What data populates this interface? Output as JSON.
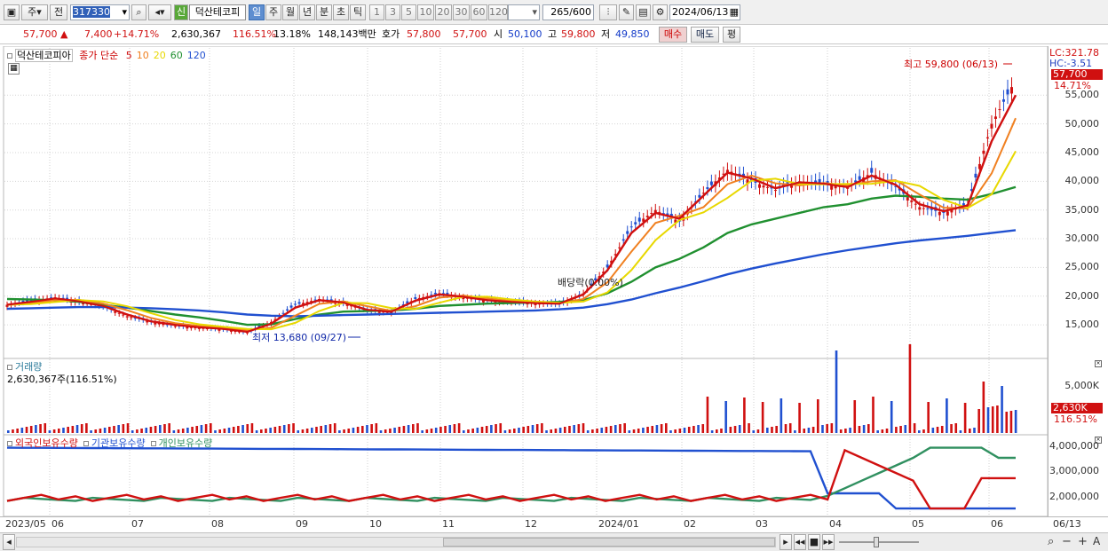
{
  "toolbar": {
    "type_label": "주",
    "period_label": "전",
    "code": "317330",
    "new_badge": "신",
    "name": "덕산테코피",
    "periods": [
      "일",
      "주",
      "월",
      "년",
      "분",
      "초",
      "틱"
    ],
    "selected_period": "일",
    "numbers": [
      "1",
      "3",
      "5",
      "10",
      "20",
      "30",
      "60",
      "120"
    ],
    "count": "265",
    "count_total": "/600",
    "date": "2024/06/13"
  },
  "quote": {
    "price": "57,700",
    "change": "7,400",
    "change_pct": "+14.71%",
    "volume": "2,630,367",
    "vol_ratio": "116.51%",
    "turnover": "13.18%",
    "amount": "148,143백만",
    "bid_label": "호가",
    "ask": "57,800",
    "bid": "57,700",
    "open_label": "시",
    "open": "50,100",
    "high_label": "고",
    "high": "59,800",
    "low_label": "저",
    "low": "49,850",
    "buy_label": "매수",
    "sell_label": "매도",
    "eval_label": "평"
  },
  "price_panel": {
    "title": "덕산테코피아",
    "ma_label": "종가 단순",
    "ma_periods": [
      "5",
      "10",
      "20",
      "60",
      "120"
    ],
    "ma_colors": [
      "#d01010",
      "#f08020",
      "#e8d800",
      "#209030",
      "#2050d0"
    ],
    "lc": "LC:321.78",
    "hc": "HC:-3.51",
    "last_price": "57,700",
    "last_pct": "14.71%",
    "high_note": "최고 59,800 (06/13)",
    "low_note": "최저 13,680 (09/27)",
    "event_note": "배당락(0.00%)",
    "ticks": [
      "55,000",
      "50,000",
      "45,000",
      "40,000",
      "35,000",
      "30,000",
      "25,000",
      "20,000",
      "15,000"
    ]
  },
  "volume_panel": {
    "title": "거래량",
    "value": "2,630,367주(116.51%)",
    "tick": "5,000K",
    "last": "2,630K",
    "last_pct": "116.51%"
  },
  "holding_panel": {
    "legend": [
      "외국인보유수량",
      "기관보유수량",
      "개인보유수량"
    ],
    "legend_colors": [
      "#d01010",
      "#2050d0",
      "#309060"
    ],
    "ticks": [
      "4,000,000",
      "3,000,000",
      "2,000,000"
    ]
  },
  "x_axis": {
    "labels": [
      "2023/05",
      "06",
      "07",
      "08",
      "09",
      "10",
      "11",
      "12",
      "2024/01",
      "02",
      "03",
      "04",
      "05",
      "06",
      "06/13"
    ]
  },
  "chart_data": {
    "type": "candlestick",
    "title": "덕산테코피아",
    "x_start": "2023/05",
    "x_end": "2024/06/13",
    "ylim": [
      11000,
      62000
    ],
    "close_approx": [
      18500,
      19200,
      19800,
      19000,
      18200,
      16500,
      15500,
      14800,
      14500,
      14200,
      13680,
      15500,
      18500,
      19500,
      18800,
      17500,
      17200,
      19500,
      20500,
      19800,
      19200,
      19000,
      18800,
      18600,
      20500,
      25000,
      32000,
      35000,
      33000,
      38000,
      42000,
      40000,
      38500,
      40000,
      39500,
      39000,
      41500,
      39000,
      35500,
      34500,
      36000,
      50000,
      57700
    ],
    "series": [
      {
        "name": "5",
        "values": [
          18500,
          19000,
          19600,
          19100,
          18300,
          16800,
          15600,
          15000,
          14600,
          14300,
          13800,
          15200,
          18000,
          19300,
          18900,
          17600,
          17300,
          19200,
          20300,
          19900,
          19300,
          19000,
          18800,
          18700,
          20300,
          24500,
          31000,
          34500,
          33500,
          37500,
          41500,
          40500,
          38800,
          39800,
          39600,
          39000,
          41000,
          39400,
          36000,
          34800,
          35800,
          47000,
          55000
        ]
      },
      {
        "name": "60",
        "values": [
          19500,
          19400,
          19300,
          19000,
          18500,
          18000,
          17400,
          16800,
          16300,
          15700,
          15000,
          15100,
          16000,
          16800,
          17300,
          17400,
          17500,
          17800,
          18300,
          18500,
          18700,
          18800,
          18900,
          19000,
          19300,
          20500,
          22500,
          25000,
          26500,
          28500,
          31000,
          32500,
          33500,
          34500,
          35500,
          36000,
          37000,
          37500,
          37300,
          37000,
          36800,
          37800,
          39000
        ]
      },
      {
        "name": "120",
        "values": [
          17800,
          17900,
          18000,
          18100,
          18100,
          18000,
          17900,
          17700,
          17500,
          17200,
          16800,
          16600,
          16500,
          16600,
          16700,
          16800,
          16900,
          17000,
          17100,
          17200,
          17300,
          17400,
          17500,
          17700,
          18000,
          18600,
          19400,
          20500,
          21500,
          22600,
          23800,
          24800,
          25700,
          26500,
          27300,
          28000,
          28600,
          29200,
          29700,
          30100,
          30500,
          31000,
          31500
        ]
      }
    ],
    "high": {
      "value": 59800,
      "date": "06/13"
    },
    "low": {
      "value": 13680,
      "date": "09/27"
    }
  }
}
